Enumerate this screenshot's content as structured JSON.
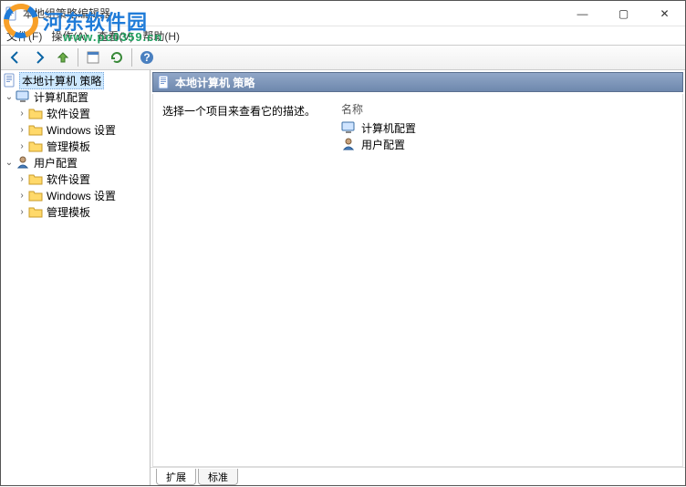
{
  "window": {
    "title": "本地组策略编辑器",
    "controls": {
      "min": "—",
      "max": "▢",
      "close": "✕"
    }
  },
  "menubar": {
    "file": "文件(F)",
    "action": "操作(A)",
    "view": "查看(V)",
    "help": "帮助(H)"
  },
  "tree": {
    "root": "本地计算机 策略",
    "computer_config": "计算机配置",
    "cc_software": "软件设置",
    "cc_windows": "Windows 设置",
    "cc_admin": "管理模板",
    "user_config": "用户配置",
    "uc_software": "软件设置",
    "uc_windows": "Windows 设置",
    "uc_admin": "管理模板"
  },
  "content": {
    "header": "本地计算机 策略",
    "desc_prompt": "选择一个项目来查看它的描述。",
    "name_header": "名称",
    "item_computer": "计算机配置",
    "item_user": "用户配置",
    "tab_extended": "扩展",
    "tab_standard": "标准"
  },
  "watermark": {
    "brand": "河东软件园",
    "url": "www.pc0359.cn"
  }
}
